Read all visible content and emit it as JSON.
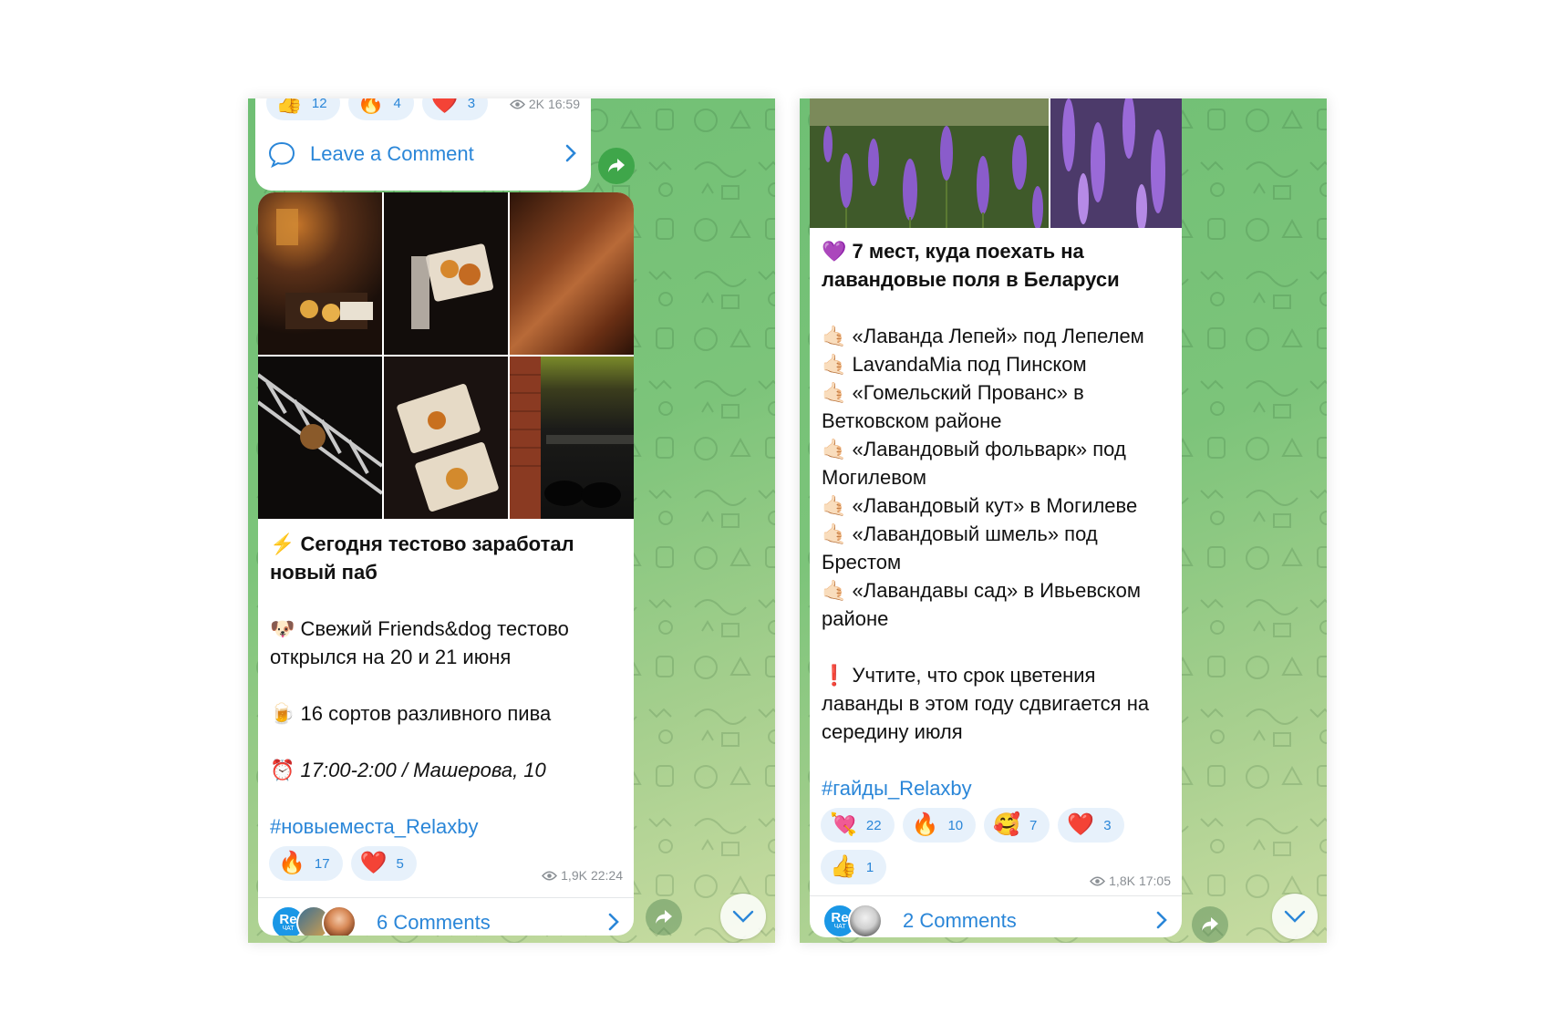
{
  "left": {
    "top_post": {
      "reactions": [
        {
          "emoji": "👍",
          "count": "12"
        },
        {
          "emoji": "🔥",
          "count": "4"
        },
        {
          "emoji": "❤️",
          "count": "3"
        }
      ],
      "views": "2K",
      "time": "16:59",
      "comment_label": "Leave a Comment"
    },
    "post": {
      "title_emoji": "⚡️",
      "title": "Сегодня тестово заработал новый паб",
      "line1_emoji": "🐶",
      "line1": "Свежий Friends&dog тестово открылся на 20 и 21 июня",
      "line2_emoji": "🍺",
      "line2": "16 сортов разливного пива",
      "line3_emoji": "⏰",
      "line3": "17:00-2:00 / Машерова, 10",
      "hashtag": "#новыеместа_Relaxby",
      "reactions": [
        {
          "emoji": "🔥",
          "count": "17"
        },
        {
          "emoji": "❤️",
          "count": "5"
        }
      ],
      "views": "1,9K",
      "time": "22:24",
      "avatar_badge": "Re",
      "avatar_badge_sub": "ЧАТ",
      "comments": "6 Comments"
    }
  },
  "right": {
    "post": {
      "title_emoji": "💜",
      "title": "7 мест, куда поехать на лавандовые поля в Беларуси",
      "list_emoji": "🤙🏻",
      "items": [
        "«Лаванда Лепей» под Лепелем",
        "LavandaMia под Пинском",
        "«Гомельский Прованс» в Ветковском районе",
        "«Лавандовый фольварк» под Могилевом",
        "«Лавандовый кут» в Могилеве",
        "«Лавандовый шмель» под Брестом",
        "«Лавандавы сад» в Ивьевском районе"
      ],
      "note_emoji": "❗️",
      "note": "Учтите, что срок цветения лаванды в этом году сдвигается на середину июля",
      "hashtag": "#гайды_Relaxby",
      "reactions": [
        {
          "emoji": "💘",
          "count": "22"
        },
        {
          "emoji": "🔥",
          "count": "10"
        },
        {
          "emoji": "🥰",
          "count": "7"
        },
        {
          "emoji": "❤️",
          "count": "3"
        },
        {
          "emoji": "👍",
          "count": "1"
        }
      ],
      "views": "1,8K",
      "time": "17:05",
      "avatar_badge": "Re",
      "avatar_badge_sub": "ЧАТ",
      "comments": "2 Comments"
    }
  },
  "colors": {
    "link": "#2a86d8",
    "reaction_bg": "#e7f1fb",
    "chat_bg": "#7cc47a"
  }
}
